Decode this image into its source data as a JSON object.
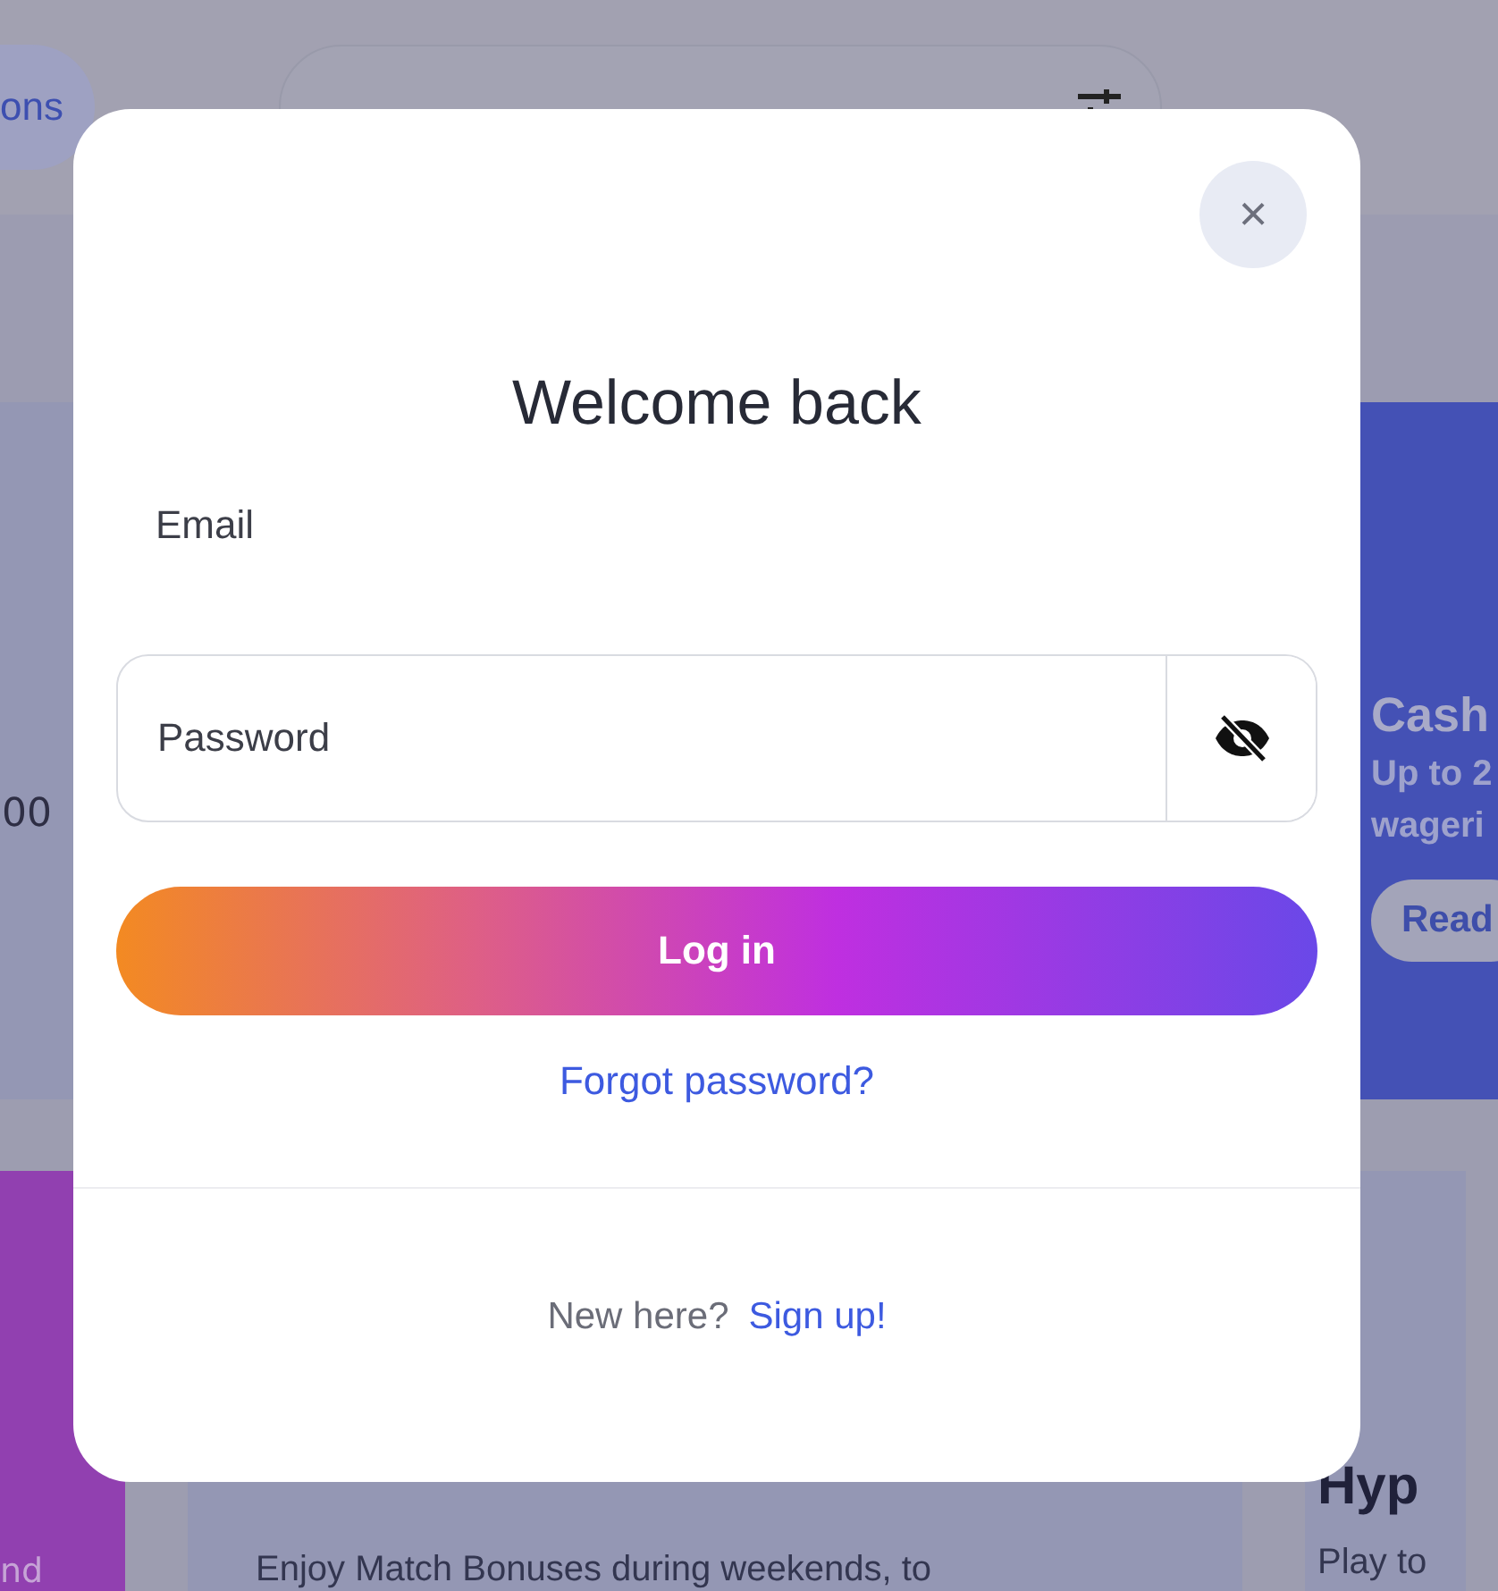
{
  "header": {
    "nav_pill": "ons"
  },
  "left_card": {
    "amount": "00"
  },
  "cashback_card": {
    "title": "Cash",
    "lines": [
      "Up to 2",
      "wageri"
    ],
    "button": "Read"
  },
  "bottom_left_card": {
    "text": "nd"
  },
  "weekend_card": {
    "text": "Enjoy Match Bonuses during weekends, to"
  },
  "hype_card": {
    "title": "Hyp",
    "text": "Play to"
  },
  "modal": {
    "close": "×",
    "title": "Welcome back",
    "fields": [
      {
        "kind": "text",
        "placeholder": "Email"
      },
      {
        "kind": "password",
        "placeholder": "Password"
      }
    ],
    "login_button": "Log in",
    "forgot_link": "Forgot password?",
    "signup_prompt": "New here?",
    "signup_link": "Sign up!"
  }
}
